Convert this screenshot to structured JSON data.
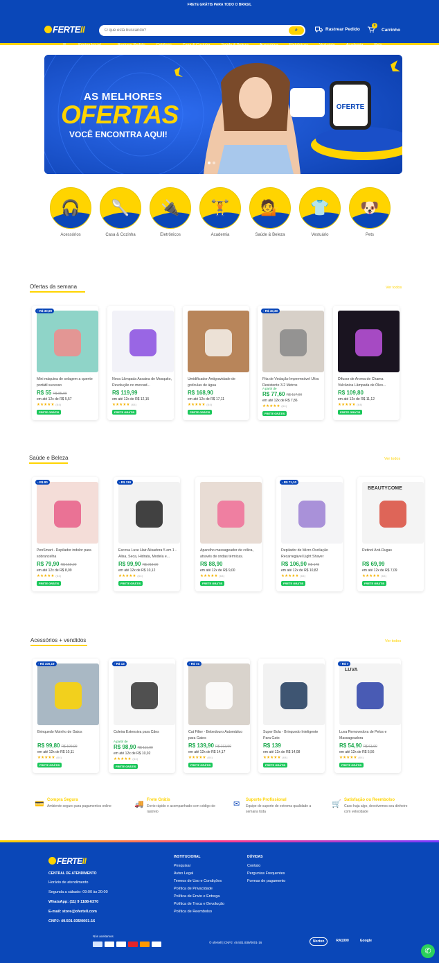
{
  "topbar": {
    "text": "FRETE GRÁTIS PARA TODO O BRASIL"
  },
  "header": {
    "logo": "FERTE",
    "logo_accent": "II",
    "search_placeholder": "O que está buscando?",
    "track_label": "Rastrear Pedido",
    "cart_label": "Carrinho",
    "cart_count": "0"
  },
  "nav": {
    "items": [
      "Página Inicial",
      "Rastrear Pedido",
      "Catálogo",
      "Casa & Cozinha",
      "Saúde & Beleza",
      "Acessórios",
      "Eletrônicos",
      "Vestuário",
      "Academia",
      "Pets"
    ]
  },
  "banner": {
    "line1": "AS MELHORES",
    "line2": "OFERTAS",
    "line3": "VOCÊ ENCONTRA AQUI!"
  },
  "categories": [
    {
      "label": "Acessórios",
      "icon": "earbuds-icon"
    },
    {
      "label": "Casa & Cozinha",
      "icon": "kitchen-utensils-icon"
    },
    {
      "label": "Eletrônicos",
      "icon": "blender-icon"
    },
    {
      "label": "Academia",
      "icon": "dumbbell-icon"
    },
    {
      "label": "Saúde & Beleza",
      "icon": "woman-icon"
    },
    {
      "label": "Vestuário",
      "icon": "hanger-icon"
    },
    {
      "label": "Pets",
      "icon": "dog-cat-icon"
    }
  ],
  "sections": [
    {
      "title": "Ofertas da semana",
      "view_all": "Ver todos",
      "products": [
        {
          "tag": "- R$ 30,99",
          "name": "Mini máquina de selagem a quente portátil sucesso",
          "price": "R$ 55",
          "old": "R$ 85,99",
          "inst": "em até 12x de R$ 5,57",
          "rating": "(64)",
          "frete": "FRETE GRÁTIS",
          "color": "#8fd4c8",
          "accent": "#f28b8b"
        },
        {
          "tag": "",
          "name": "Nova Lâmpada Assaina de Mosquito, Revolução no mercad...",
          "price": "R$ 119,99",
          "old": "",
          "inst": "em até 12x de R$ 12,15",
          "rating": "(64)",
          "frete": "FRETE GRÁTIS",
          "color": "#f2f2f8",
          "accent": "#8a4de0"
        },
        {
          "tag": "",
          "name": "Umidificador Antigravidade de gotículas de água",
          "price": "R$ 168,90",
          "old": "",
          "inst": "em até 12x de R$ 17,11",
          "rating": "(64)",
          "frete": "FRETE GRÁTIS",
          "color": "#b8855a",
          "accent": "#f4f1ec"
        },
        {
          "tag": "- R$ 40,30",
          "name": "Fita de Vedação Impermeável Ultra Resistente 3.2 Metros",
          "price": "R$ 77,60",
          "old": "R$ 117,90",
          "inst": "em até 12x de R$ 7,86",
          "rating": "(64)",
          "frete": "FRETE GRÁTIS",
          "color": "#d7d0c8",
          "accent": "#888888",
          "apartir": "A partir de"
        },
        {
          "tag": "",
          "name": "Difusor de Aroma de Chama Vulcânica Lâmpada de Óleo...",
          "price": "R$ 109,80",
          "old": "",
          "inst": "em até 12x de R$ 11,12",
          "rating": "(64)",
          "frete": "FRETE GRÁTIS",
          "color": "#1a1420",
          "accent": "#c054e0"
        }
      ]
    },
    {
      "title": "Saúde e Beleza",
      "view_all": "Ver todos",
      "products": [
        {
          "tag": "- R$ 80",
          "name": "PenSmart - Depilador indolor para sobrancelha",
          "price": "R$ 79,90",
          "old": "R$ 159,90",
          "inst": "em até 12x de R$ 8,09",
          "rating": "(64)",
          "frete": "FRETE GRÁTIS",
          "color": "#f4ddd8",
          "accent": "#e85f8a"
        },
        {
          "tag": "- R$ 119",
          "name": "Escova Luxe Hair Alisadora 5 em 1 - Alisa, Seca, Hidrata, Modela e...",
          "price": "R$ 99,90",
          "old": "R$ 218,90",
          "inst": "em até 12x de R$ 10,12",
          "rating": "(64)",
          "frete": "FRETE GRÁTIS",
          "color": "#f2f2f2",
          "accent": "#222222"
        },
        {
          "tag": "",
          "name": "Aparelho massageador de cólica, através de ondas térmicas.",
          "price": "R$ 88,90",
          "old": "",
          "inst": "em até 12x de R$ 9,00",
          "rating": "(64)",
          "frete": "FRETE GRÁTIS",
          "color": "#e8dcd4",
          "accent": "#f06f98"
        },
        {
          "tag": "- R$ 71,10",
          "name": "Depilador de Micro Oscilação Recarregável Light Shaver",
          "price": "R$ 106,90",
          "old": "R$ 178",
          "inst": "em até 12x de R$ 10,82",
          "rating": "(64)",
          "frete": "FRETE GRÁTIS",
          "color": "#f4f4f6",
          "accent": "#9b7fd4"
        },
        {
          "tag": "",
          "name": "Retinol Anti-Rugas",
          "price": "R$ 69,99",
          "old": "",
          "inst": "em até 12x de R$ 7,09",
          "rating": "(64)",
          "frete": "FRETE GRÁTIS",
          "color": "#f4f4f4",
          "accent": "#d94b3c",
          "brand": "BEAUTYCOME"
        }
      ]
    },
    {
      "title": "Acessórios + vendidos",
      "view_all": "Ver todos",
      "products": [
        {
          "tag": "- R$ 100,19",
          "name": "Brinquedo Moinho de Gatos",
          "price": "R$ 99,80",
          "old": "R$ 199,99",
          "inst": "em até 12x de R$ 10,11",
          "rating": "(64)",
          "frete": "FRETE GRÁTIS",
          "color": "#a9b8c4",
          "accent": "#ffd400"
        },
        {
          "tag": "- R$ 13",
          "name": "Coleira Extensiva para Cães",
          "price": "R$ 98,90",
          "old": "R$ 111,90",
          "inst": "em até 12x de R$ 10,02",
          "rating": "(64)",
          "frete": "FRETE GRÁTIS",
          "color": "#f4f4f4",
          "accent": "#333333",
          "apartir": "A partir de"
        },
        {
          "tag": "- R$ 74",
          "name": "Cat Filter - Bebedouro Automático para Gatos",
          "price": "R$ 139,90",
          "old": "R$ 213,90",
          "inst": "em até 12x de R$ 14,17",
          "rating": "(64)",
          "frete": "FRETE GRÁTIS",
          "color": "#d9d3cc",
          "accent": "#ffffff"
        },
        {
          "tag": "",
          "name": "Super Bola - Brinquedo Inteligente Para Gato",
          "price": "R$ 139",
          "old": "",
          "inst": "em até 12x de R$ 14,08",
          "rating": "(64)",
          "frete": "FRETE GRÁTIS",
          "color": "#f2f2f2",
          "accent": "#1e3a5c"
        },
        {
          "tag": "- R$ 7",
          "name": "Luva Removedora de Pelos e Massageadora",
          "price": "R$ 54,90",
          "old": "R$ 61,90",
          "inst": "em até 12x de R$ 5,56",
          "rating": "(64)",
          "frete": "FRETE GRÁTIS",
          "color": "#f4f4f4",
          "accent": "#2a3fa8",
          "brand": "LUVA"
        }
      ]
    }
  ],
  "features": [
    {
      "title": "Compra Segura",
      "desc": "Ambiente seguro para pagamentos online",
      "icon": "secure-card-icon"
    },
    {
      "title": "Frete Grátis",
      "desc": "Envio rápido e acompanhado com código de rastreio",
      "icon": "truck-icon"
    },
    {
      "title": "Suporte Profissional",
      "desc": "Equipe de suporte de extrema qualidade a semana toda",
      "icon": "mail-icon"
    },
    {
      "title": "Satisfação ou Reembolso",
      "desc": "Caso haja algo, devolvemos seu dinheiro com velocidade",
      "icon": "cart-icon"
    }
  ],
  "footer": {
    "logo": "FERTE",
    "logo_accent": "II",
    "central_title": "CENTRAL DE ATENDIMENTO",
    "hours_label": "Horário de atendimento",
    "hours": "Segunda a sábado: 09:00 às 20:00",
    "whatsapp": "WhatsApp: (11) 9 1188-6370",
    "email": "E-mail: store@ofertell.com",
    "cnpj": "CNPJ: 49.501.935/0001-16",
    "inst_title": "INSTITUCIONAL",
    "inst_links": [
      "Pesquisar",
      "Aviso Legal",
      "Termos de Uso e Condições",
      "Política de Privacidade",
      "Política de Envio e Entrega",
      "Política de Troca e Devolução",
      "Política de Reembolso"
    ],
    "duvidas_title": "DÚVIDAS",
    "duvidas_links": [
      "Contato",
      "Perguntas Frequentes",
      "Formas de pagamento"
    ],
    "aceitamos": "Nós aceitamos",
    "payments": [
      "PIX",
      "Boleto",
      "elo",
      "Hipercard",
      "Mastercard",
      "VISA"
    ],
    "copyright": "© ofertell | CNPJ: 49.501.939/0001-16",
    "seals": [
      "Norton",
      "RA1000",
      "Google"
    ]
  }
}
